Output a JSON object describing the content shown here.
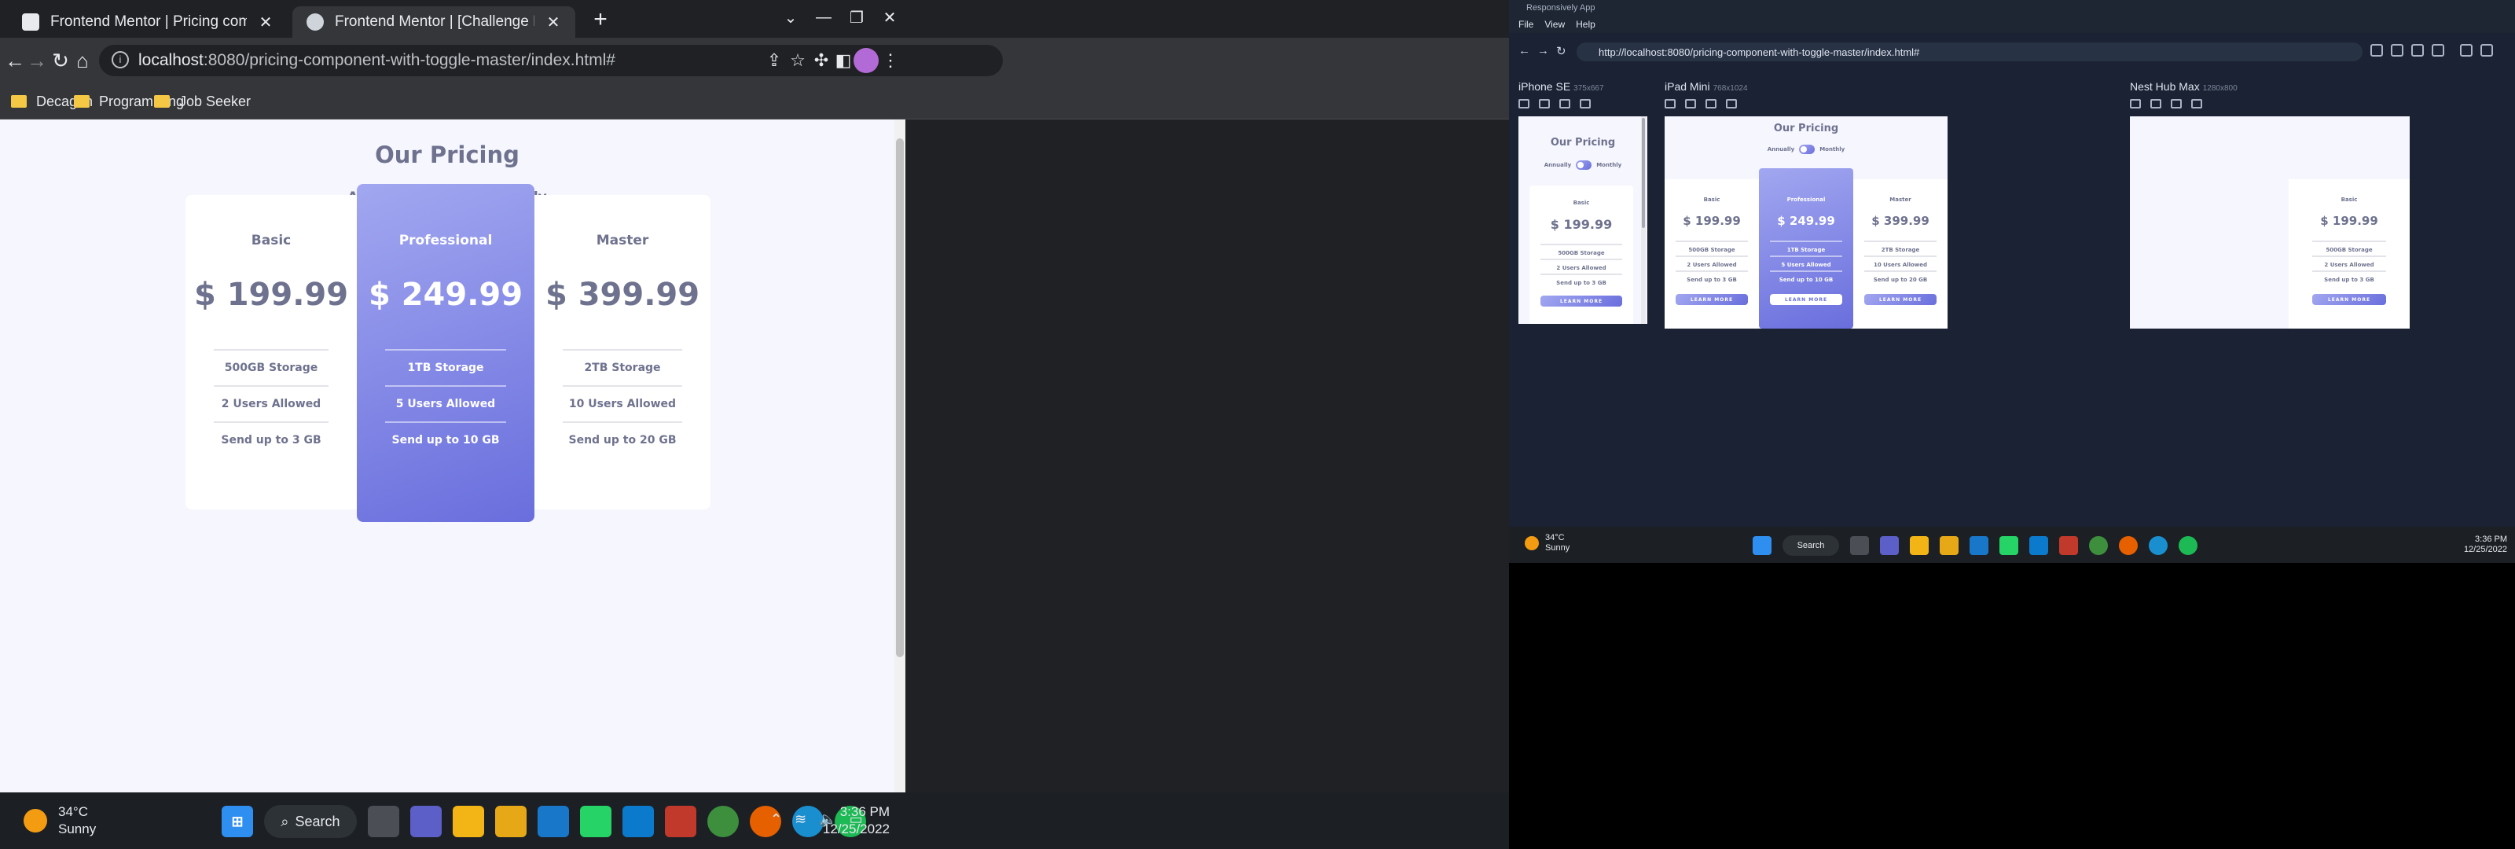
{
  "browser": {
    "tabs": [
      {
        "title": "Frontend Mentor | Pricing compo",
        "active": false
      },
      {
        "title": "Frontend Mentor | [Challenge Na",
        "active": true
      }
    ],
    "url_host": "localhost",
    "url_path": ":8080/pricing-component-with-toggle-master/index.html#",
    "bookmarks": [
      "Decagon",
      "Programming",
      "Job Seeker"
    ]
  },
  "pricing": {
    "title": "Our Pricing",
    "annually": "Annually",
    "monthly": "Monthly",
    "button": "LEARN MORE",
    "plans": [
      {
        "name": "Basic",
        "price": "$ 199.99",
        "features": [
          "500GB Storage",
          "2 Users Allowed",
          "Send up to 3 GB"
        ]
      },
      {
        "name": "Professional",
        "price": "$ 249.99",
        "features": [
          "1TB Storage",
          "5 Users Allowed",
          "Send up to 10 GB"
        ]
      },
      {
        "name": "Master",
        "price": "$ 399.99",
        "features": [
          "2TB Storage",
          "10 Users Allowed",
          "Send up to 20 GB"
        ]
      }
    ]
  },
  "taskbar": {
    "temp": "34°C",
    "condition": "Sunny",
    "search": "Search",
    "time": "3:36 PM",
    "date": "12/25/2022"
  },
  "responsively": {
    "app_title": "Responsively App",
    "menu": [
      "File",
      "View",
      "Help"
    ],
    "url": "http://localhost:8080/pricing-component-with-toggle-master/index.html#",
    "devices": [
      {
        "name": "iPhone SE",
        "size": "375x667"
      },
      {
        "name": "iPad Mini",
        "size": "768x1024"
      },
      {
        "name": "Nest Hub Max",
        "size": "1280x800"
      }
    ]
  },
  "colors": {
    "accent_light": "#a2a7f0",
    "accent_dark": "#696edd",
    "text": "#6e728e",
    "page_bg": "#f6f6fe"
  }
}
